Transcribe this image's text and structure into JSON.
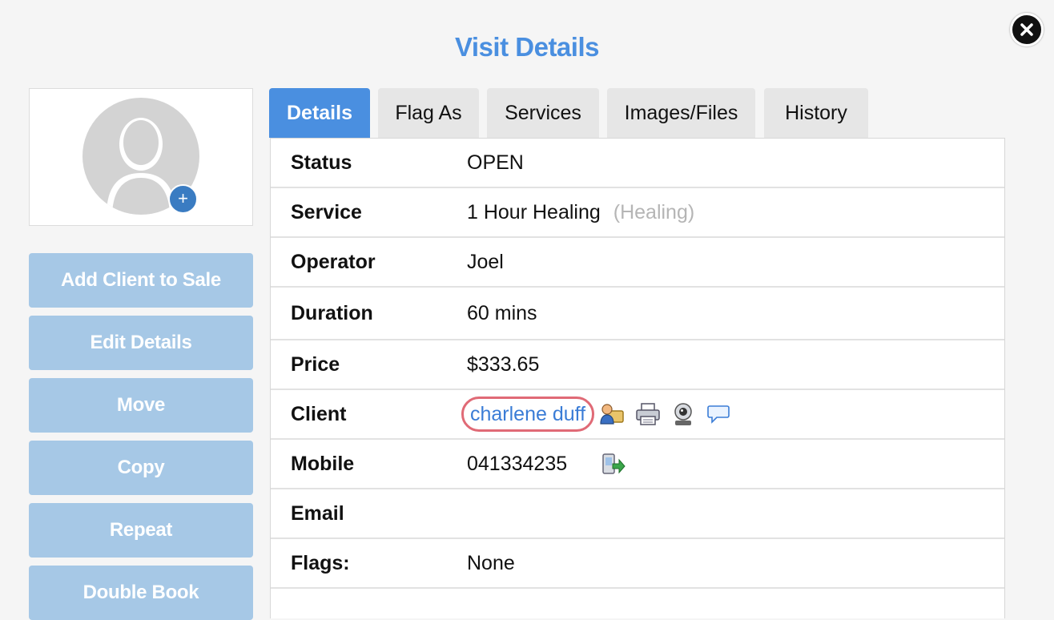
{
  "dialog": {
    "title": "Visit Details",
    "close_icon": "close-icon"
  },
  "avatar": {
    "icon": "user-placeholder-icon",
    "add_icon_label": "+"
  },
  "actions": [
    {
      "label": "Add Client to Sale"
    },
    {
      "label": "Edit Details"
    },
    {
      "label": "Move"
    },
    {
      "label": "Copy"
    },
    {
      "label": "Repeat"
    },
    {
      "label": "Double Book"
    }
  ],
  "tabs": [
    {
      "label": "Details",
      "active": true
    },
    {
      "label": "Flag As",
      "active": false
    },
    {
      "label": "Services",
      "active": false
    },
    {
      "label": "Images/Files",
      "active": false
    },
    {
      "label": "History",
      "active": false
    }
  ],
  "details": {
    "status": {
      "label": "Status",
      "value": "OPEN"
    },
    "service": {
      "label": "Service",
      "value": "1 Hour Healing",
      "category": "(Healing)"
    },
    "operator": {
      "label": "Operator",
      "value": "Joel"
    },
    "duration": {
      "label": "Duration",
      "value": "60 mins"
    },
    "price": {
      "label": "Price",
      "value": "$333.65"
    },
    "client": {
      "label": "Client",
      "value": "charlene duff",
      "icons": [
        "client-card-icon",
        "print-icon",
        "webcam-icon",
        "message-icon"
      ]
    },
    "mobile": {
      "label": "Mobile",
      "value": "041334235",
      "icon": "send-sms-icon"
    },
    "email": {
      "label": "Email",
      "value": ""
    },
    "flags": {
      "label": "Flags:",
      "value": "None"
    }
  },
  "colors": {
    "accent": "#4a8fe0",
    "button": "#a6c8e6",
    "link": "#3a7cd6",
    "highlight": "#e06a76"
  }
}
